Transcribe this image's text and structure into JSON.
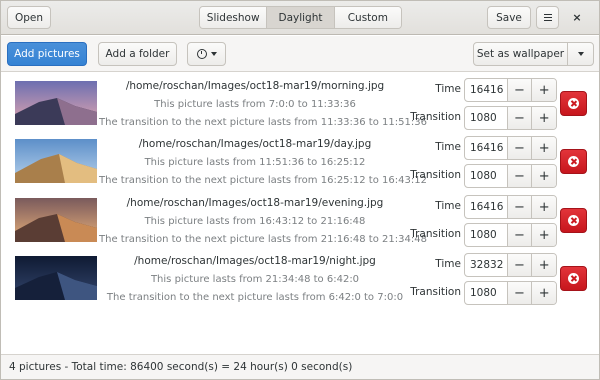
{
  "header": {
    "open_label": "Open",
    "tabs": [
      {
        "label": "Slideshow",
        "active": false
      },
      {
        "label": "Daylight",
        "active": true
      },
      {
        "label": "Custom",
        "active": false
      }
    ],
    "save_label": "Save",
    "menu_icon": "hamburger-icon",
    "close_glyph": "×"
  },
  "toolbar": {
    "add_pictures_label": "Add pictures",
    "add_folder_label": "Add a folder",
    "timer_icon": "timer-icon",
    "set_wallpaper_label": "Set as wallpaper"
  },
  "labels": {
    "time": "Time",
    "transition": "Transition",
    "minus": "−",
    "plus": "+"
  },
  "pictures": [
    {
      "path": "/home/roschan/Images/oct18-mar19/morning.jpg",
      "lasts": "This picture lasts from 7:0:0 to 11:33:36",
      "transition_text": "The transition to the next picture lasts from 11:33:36 to 11:51:36",
      "time": "16416",
      "transition": "1080",
      "thumb_theme": "morning"
    },
    {
      "path": "/home/roschan/Images/oct18-mar19/day.jpg",
      "lasts": "This picture lasts from 11:51:36 to 16:25:12",
      "transition_text": "The transition to the next picture lasts from 16:25:12 to 16:43:12",
      "time": "16416",
      "transition": "1080",
      "thumb_theme": "day"
    },
    {
      "path": "/home/roschan/Images/oct18-mar19/evening.jpg",
      "lasts": "This picture lasts from 16:43:12 to 21:16:48",
      "transition_text": "The transition to the next picture lasts from 21:16:48 to 21:34:48",
      "time": "16416",
      "transition": "1080",
      "thumb_theme": "evening"
    },
    {
      "path": "/home/roschan/Images/oct18-mar19/night.jpg",
      "lasts": "This picture lasts from 21:34:48 to 6:42:0",
      "transition_text": "The transition to the next picture lasts from 6:42:0 to 7:0:0",
      "time": "32832",
      "transition": "1080",
      "thumb_theme": "night"
    }
  ],
  "status": {
    "text": "4 pictures - Total time: 86400 second(s) = 24 hour(s) 0 second(s)"
  },
  "colors": {
    "accent_blue": "#3583d4",
    "delete_red": "#cc1a21",
    "secondary_text": "#7b7f82"
  }
}
